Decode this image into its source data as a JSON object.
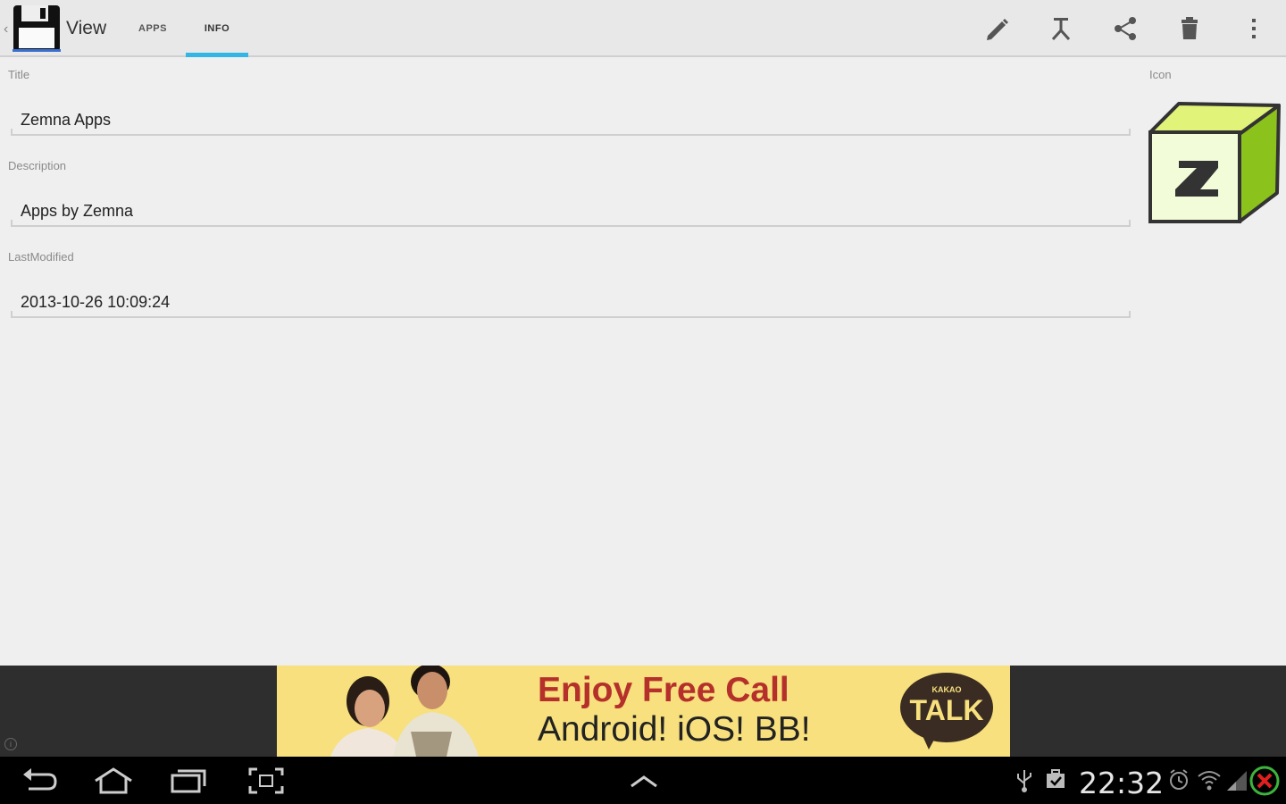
{
  "header": {
    "title": "View",
    "tabs": [
      {
        "label": "APPS"
      },
      {
        "label": "INFO"
      }
    ]
  },
  "form": {
    "title_label": "Title",
    "title_value": "Zemna Apps",
    "description_label": "Description",
    "description_value": "Apps by Zemna",
    "modified_label": "LastModified",
    "modified_value": "2013-10-26 10:09:24",
    "icon_label": "Icon"
  },
  "ad": {
    "line1": "Enjoy Free Call",
    "line2": "Android! iOS! BB!",
    "brand_small": "KAKAO",
    "brand_big": "TALK"
  },
  "status": {
    "time": "22:32"
  },
  "icons": {
    "actions": [
      "edit-icon",
      "pin-icon",
      "share-icon",
      "delete-icon",
      "overflow-icon"
    ],
    "nav": [
      "back-icon",
      "home-icon",
      "recent-apps-icon",
      "screenshot-icon",
      "expand-icon"
    ],
    "status": [
      "usb-icon",
      "notification-icon",
      "alarm-icon",
      "wifi-icon",
      "signal-icon",
      "no-sim-icon"
    ]
  },
  "colors": {
    "tab_indicator": "#33b5e5",
    "ad_background": "#f7e07d",
    "ad_headline": "#b5302b",
    "icon_green": "#b6e04a"
  }
}
